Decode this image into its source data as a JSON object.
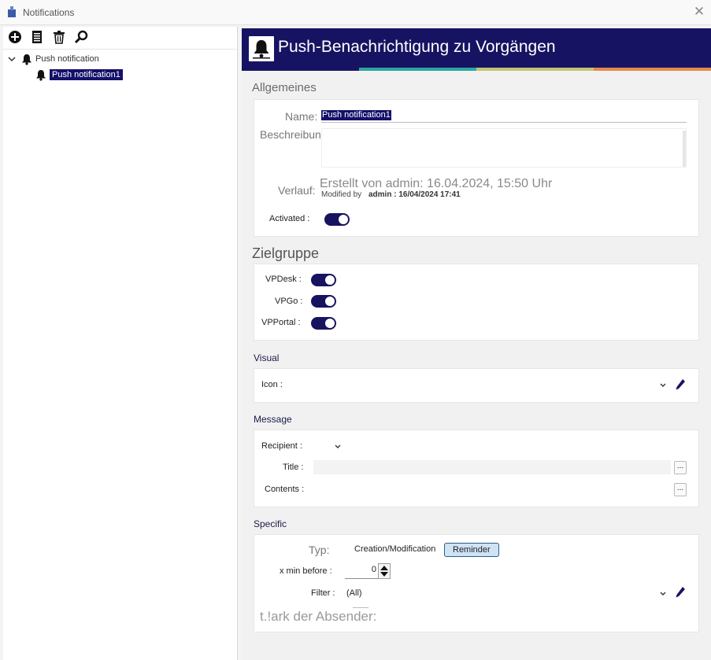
{
  "window": {
    "title": "Notifications",
    "close_glyph": "✕"
  },
  "toolbar": {
    "items": [
      {
        "icon": "add-circle-icon"
      },
      {
        "icon": "document-list-icon"
      },
      {
        "icon": "trash-icon"
      },
      {
        "icon": "search-icon"
      }
    ]
  },
  "tree": {
    "root_label": "Push notification",
    "child_label": "Push notification1"
  },
  "header": {
    "title": "Push-Benachrichtigung zu Vorgängen",
    "icon": "bell-icon"
  },
  "colors": {
    "header_bg": "#171363",
    "accent": "#14106a",
    "stripes": [
      "#171363",
      "#2aa6a2",
      "#c4c472",
      "#e58a4a"
    ]
  },
  "general": {
    "section_title": "Allgemeines",
    "name_label": "Name:",
    "name_value": "Push notification1",
    "description_label": "Beschreibung:",
    "history_label": "Verlauf:",
    "created_text": "Erstellt von admin: 16.04.2024, 15:50 Uhr",
    "modified_prefix": "Modified by",
    "modified_value": "admin : 16/04/2024 17:41",
    "activated_label": "Activated :",
    "activated_on": true
  },
  "target": {
    "section_title": "Zielgruppe",
    "items": [
      {
        "label": "VPDesk :",
        "on": true
      },
      {
        "label": "VPGo :",
        "on": true
      },
      {
        "label": "VPPortal :",
        "on": true
      }
    ]
  },
  "visual": {
    "section_title": "Visual",
    "icon_label": "Icon :"
  },
  "message": {
    "section_title": "Message",
    "recipient_label": "Recipient :",
    "title_label": "Title :",
    "contents_label": "Contents :",
    "ellipsis": "..."
  },
  "specific": {
    "section_title": "Specific",
    "type_label": "Typ:",
    "type_options": [
      "Creation/Modification",
      "Reminder"
    ],
    "type_selected": "Reminder",
    "xmin_label": "x min before :",
    "xmin_value": "0",
    "filter_label": "Filter :",
    "filter_value": "(All)",
    "extra_label": "t.!ark der Absender:"
  }
}
